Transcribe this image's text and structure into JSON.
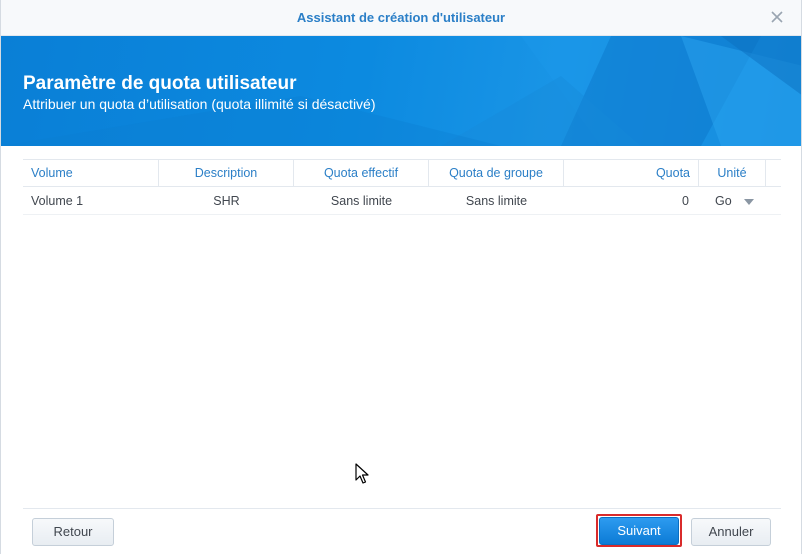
{
  "window": {
    "title": "Assistant de création d'utilisateur"
  },
  "banner": {
    "heading": "Paramètre de quota utilisateur",
    "subheading": "Attribuer un quota d’utilisation (quota illimité si désactivé)"
  },
  "grid": {
    "columns": [
      "Volume",
      "Description",
      "Quota effectif",
      "Quota de groupe",
      "Quota",
      "Unité"
    ],
    "rows": [
      {
        "volume": "Volume 1",
        "description": "SHR",
        "effective_quota": "Sans limite",
        "group_quota": "Sans limite",
        "quota": "0",
        "unit": "Go"
      }
    ]
  },
  "footer": {
    "back_label": "Retour",
    "next_label": "Suivant",
    "cancel_label": "Annuler"
  },
  "colors": {
    "accent": "#2b7fc7",
    "banner": "#0c8ae0",
    "primary_button": "#1a8be6",
    "highlight_outline": "#d92b2b"
  },
  "icons": {
    "close": "close-icon",
    "dropdown": "chevron-down-icon",
    "cursor": "mouse-pointer-icon"
  }
}
